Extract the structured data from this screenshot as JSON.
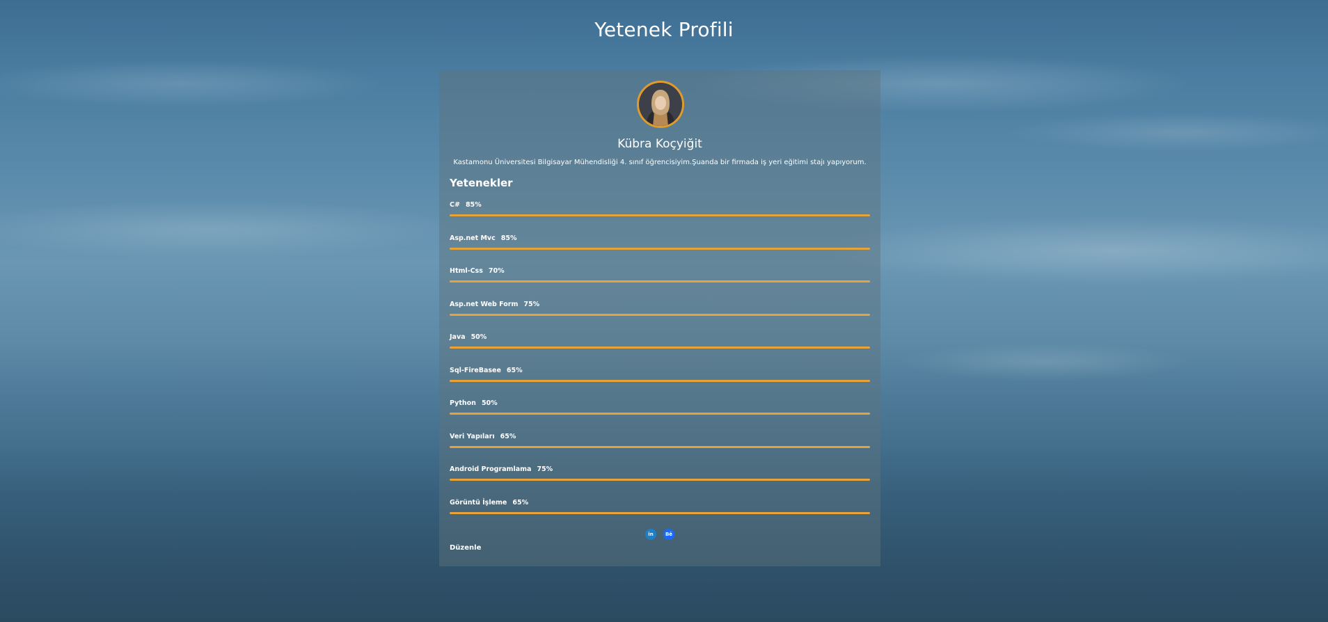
{
  "page": {
    "title": "Yetenek Profili"
  },
  "profile": {
    "name": "Kübra Koçyiğit",
    "bio": "Kastamonu Üniversitesi Bilgisayar Mühendisliği 4. sınıf öğrencisiyim.Şuanda bir firmada iş yeri eğitimi stajı yapıyorum.",
    "avatar_icon": "profile-photo"
  },
  "skills": {
    "heading": "Yetenekler",
    "items": [
      {
        "name": "C#",
        "percent_label": "85%",
        "level": 0.85
      },
      {
        "name": "Asp.net Mvc",
        "percent_label": "85%",
        "level": 0.85
      },
      {
        "name": "Html-Css",
        "percent_label": "70%",
        "level": 0.7
      },
      {
        "name": "Asp.net Web Form",
        "percent_label": "75%",
        "level": 0.75
      },
      {
        "name": "Java",
        "percent_label": "50%",
        "level": 0.5
      },
      {
        "name": "Sql-FireBasee",
        "percent_label": "65%",
        "level": 0.65
      },
      {
        "name": "Python",
        "percent_label": "50%",
        "level": 0.5
      },
      {
        "name": "Veri Yapıları",
        "percent_label": "65%",
        "level": 0.65
      },
      {
        "name": "Android Programlama",
        "percent_label": "75%",
        "level": 0.75
      },
      {
        "name": "Görüntü İşleme",
        "percent_label": "65%",
        "level": 0.65
      }
    ]
  },
  "social": {
    "linkedin_label": "in",
    "behance_label": "Bē",
    "linkedin_icon": "linkedin-icon",
    "behance_icon": "behance-icon"
  },
  "actions": {
    "edit_label": "Düzenle"
  },
  "colors": {
    "accent": "#e8a23a",
    "avatar_border": "#e09b2d",
    "linkedin": "#1f7fc4",
    "behance": "#1769ff"
  }
}
